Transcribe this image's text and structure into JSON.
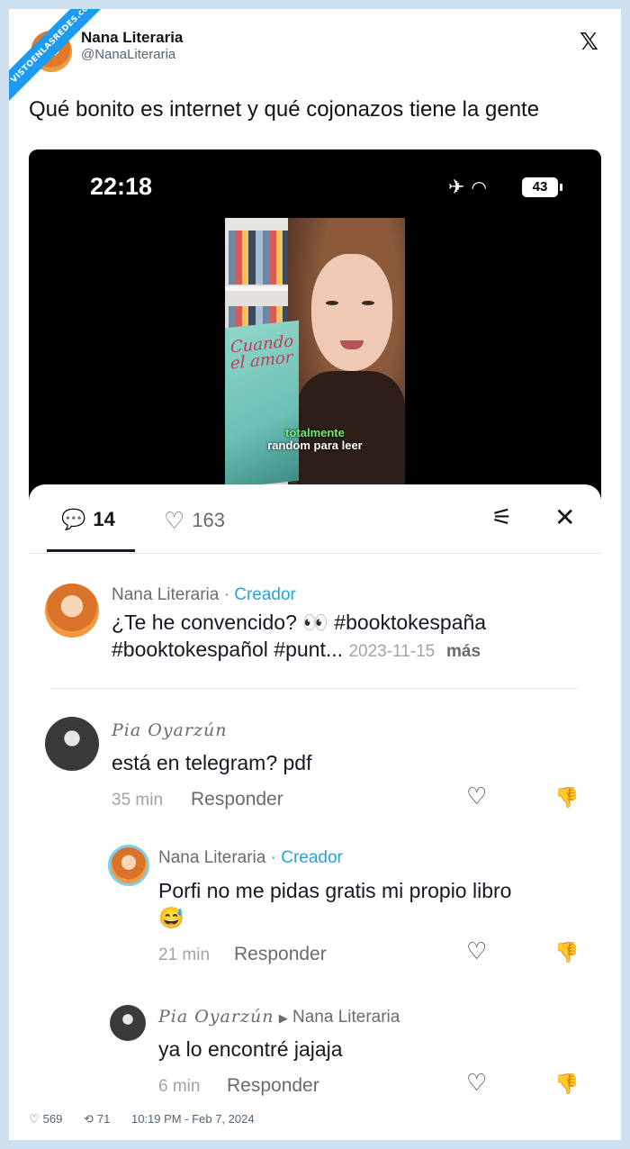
{
  "watermark": "VISTOENLASREDES.com",
  "tweet": {
    "author_name": "Nana Literaria",
    "author_handle": "@NanaLiteraria",
    "text": "Qué bonito es internet y qué cojonazos tiene la gente",
    "likes": "569",
    "retweets": "71",
    "timestamp": "10:19 PM - Feb 7, 2024"
  },
  "phone": {
    "time": "22:18",
    "battery": "43"
  },
  "video": {
    "book_title": "Cuando el amor",
    "caption_highlight": "totalmente",
    "caption_rest": "random para leer"
  },
  "comments_panel": {
    "comment_count": "14",
    "like_count": "163",
    "creator_post": {
      "name": "Nana Literaria",
      "badge": "· Creador",
      "text_line1": "¿Te he convencido? 👀 #booktokespaña",
      "text_line2": "#booktokespañol #punt...",
      "date": "2023-11-15",
      "more": "más"
    },
    "comments": [
      {
        "name": "Pia Oyarzún",
        "text": "está en telegram? pdf",
        "time": "35 min",
        "reply_label": "Responder"
      }
    ],
    "replies": [
      {
        "name": "Nana Literaria",
        "badge": "· Creador",
        "text_line1": "Porfi no me pidas gratis mi propio libro",
        "text_line2": "😅",
        "time": "21 min",
        "reply_label": "Responder"
      },
      {
        "name": "Pia Oyarzún",
        "reply_to": "Nana Literaria",
        "text": "ya lo encontré jajaja",
        "time": "6 min",
        "reply_label": "Responder"
      }
    ]
  },
  "icons": {
    "x_logo": "x-logo-icon",
    "comment": "comment-bubble-icon",
    "like": "heart-icon",
    "filter": "sliders-icon",
    "close": "close-icon",
    "dislike": "thumbs-down-icon",
    "retweet": "retweet-icon"
  },
  "colors": {
    "creator_badge": "#2aa3d6",
    "caption_highlight": "#6bf06b",
    "ribbon": "#1d9bf0"
  }
}
